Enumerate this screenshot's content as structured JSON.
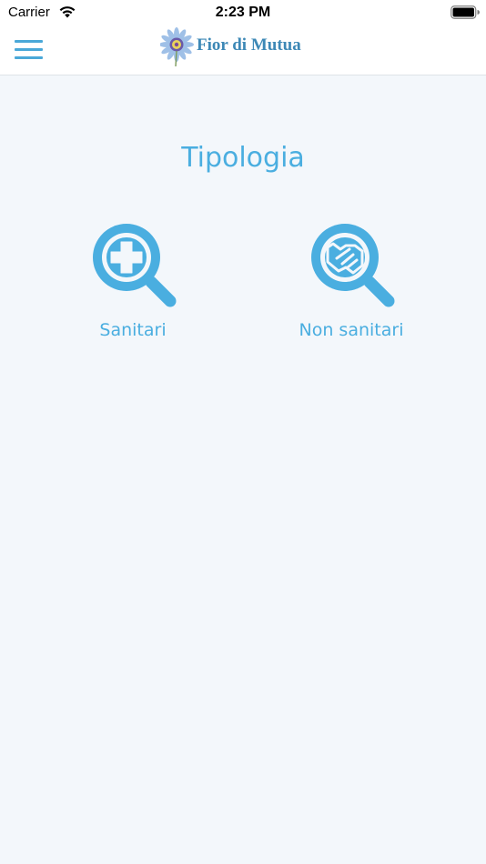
{
  "status_bar": {
    "carrier": "Carrier",
    "time": "2:23 PM",
    "wifi_icon": "wifi-icon",
    "battery_icon": "battery-icon"
  },
  "nav": {
    "menu_icon": "hamburger-menu-icon",
    "logo_text": "Fior di Mutua"
  },
  "main": {
    "title": "Tipologia",
    "choices": [
      {
        "label": "Sanitari",
        "icon": "medical-search-icon"
      },
      {
        "label": "Non sanitari",
        "icon": "handshake-search-icon"
      }
    ]
  },
  "colors": {
    "accent": "#4aaee0",
    "logo_text": "#3d88b6",
    "background": "#f3f7fb",
    "navbar": "#ffffff"
  }
}
